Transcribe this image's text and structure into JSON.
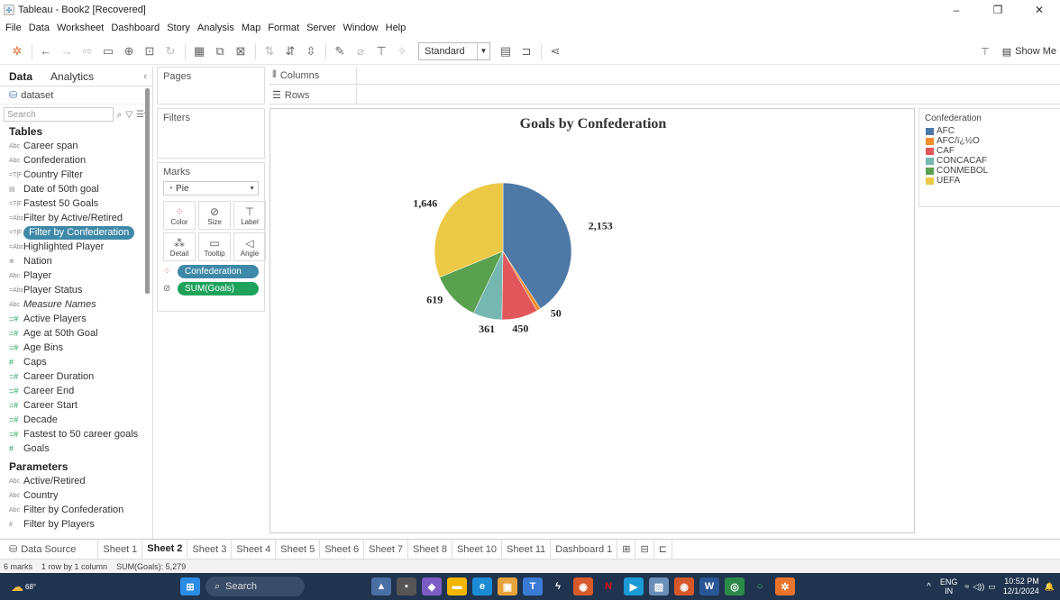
{
  "window": {
    "title": "Tableau - Book2 [Recovered]",
    "minimize": "–",
    "restore": "❐",
    "close": "✕"
  },
  "menu": [
    "File",
    "Data",
    "Worksheet",
    "Dashboard",
    "Story",
    "Analysis",
    "Map",
    "Format",
    "Server",
    "Window",
    "Help"
  ],
  "toolbar": {
    "fit": "Standard",
    "show_me": "Show Me"
  },
  "left_pane": {
    "tab_data": "Data",
    "tab_analytics": "Analytics",
    "datasource": "dataset",
    "search_placeholder": "Search",
    "tables_header": "Tables",
    "dimensions": [
      {
        "type": "Abc",
        "name": "Career span"
      },
      {
        "type": "Abc",
        "name": "Confederation"
      },
      {
        "type": "=T|F",
        "name": "Country Filter"
      },
      {
        "type": "date",
        "name": "Date of 50th goal"
      },
      {
        "type": "=T|F",
        "name": "Fastest 50 Goals"
      },
      {
        "type": "=Abc",
        "name": "Filter by Active/Retired"
      },
      {
        "type": "=T|F",
        "name": "Filter by Confederation",
        "highlight": true
      },
      {
        "type": "=Abc",
        "name": "Highlighted Player"
      },
      {
        "type": "geo",
        "name": "Nation"
      },
      {
        "type": "Abc",
        "name": "Player"
      },
      {
        "type": "=Abc",
        "name": "Player Status"
      },
      {
        "type": "Abc",
        "name": "Measure Names",
        "italic": true
      }
    ],
    "measures": [
      {
        "type": "=#",
        "name": "Active Players"
      },
      {
        "type": "=#",
        "name": "Age at 50th Goal"
      },
      {
        "type": "=#",
        "name": "Age Bins"
      },
      {
        "type": "#",
        "name": "Caps"
      },
      {
        "type": "=#",
        "name": "Career Duration"
      },
      {
        "type": "=#",
        "name": "Career End"
      },
      {
        "type": "=#",
        "name": "Career Start"
      },
      {
        "type": "=#",
        "name": "Decade"
      },
      {
        "type": "=#",
        "name": "Fastest to 50 career goals"
      },
      {
        "type": "#",
        "name": "Goals"
      }
    ],
    "parameters_header": "Parameters",
    "parameters": [
      {
        "type": "Abc",
        "name": "Active/Retired"
      },
      {
        "type": "Abc",
        "name": "Country"
      },
      {
        "type": "Abc",
        "name": "Filter by Confederation"
      },
      {
        "type": "#",
        "name": "Filter by Players"
      }
    ]
  },
  "cards": {
    "pages": "Pages",
    "filters": "Filters",
    "marks": "Marks",
    "mark_type": "Pie",
    "buttons": [
      "Color",
      "Size",
      "Label",
      "Detail",
      "Tooltip",
      "Angle"
    ],
    "pill_color": "Confederation",
    "pill_angle": "SUM(Goals)"
  },
  "shelves": {
    "columns": "Columns",
    "rows": "Rows"
  },
  "chart_data": {
    "type": "pie",
    "title": "Goals by Confederation",
    "categories": [
      "AFC",
      "AFC/ï¿½O",
      "CAF",
      "CONCACAF",
      "CONMEBOL",
      "UEFA"
    ],
    "values": [
      2153,
      50,
      450,
      361,
      619,
      1646
    ],
    "labels": [
      "2,153",
      "50",
      "450",
      "361",
      "619",
      "1,646"
    ],
    "colors": [
      "#4e79a7",
      "#f28e2b",
      "#e15759",
      "#76b7b2",
      "#59a14f",
      "#edc948"
    ],
    "legend_title": "Confederation",
    "legend_position": "right"
  },
  "sheets": {
    "datasource": "Data Source",
    "tabs": [
      "Sheet 1",
      "Sheet 2",
      "Sheet 3",
      "Sheet 4",
      "Sheet 5",
      "Sheet 6",
      "Sheet 7",
      "Sheet 8",
      "Sheet 10",
      "Sheet 11",
      "Dashboard 1"
    ],
    "active": "Sheet 2"
  },
  "status": {
    "marks": "6 marks",
    "dims": "1 row by 1 column",
    "sum": "SUM(Goals): 5,279"
  },
  "taskbar": {
    "weather": "68°",
    "search": "Search",
    "lang1": "ENG",
    "lang2": "IN",
    "time": "10:52 PM",
    "date": "12/1/2024"
  }
}
